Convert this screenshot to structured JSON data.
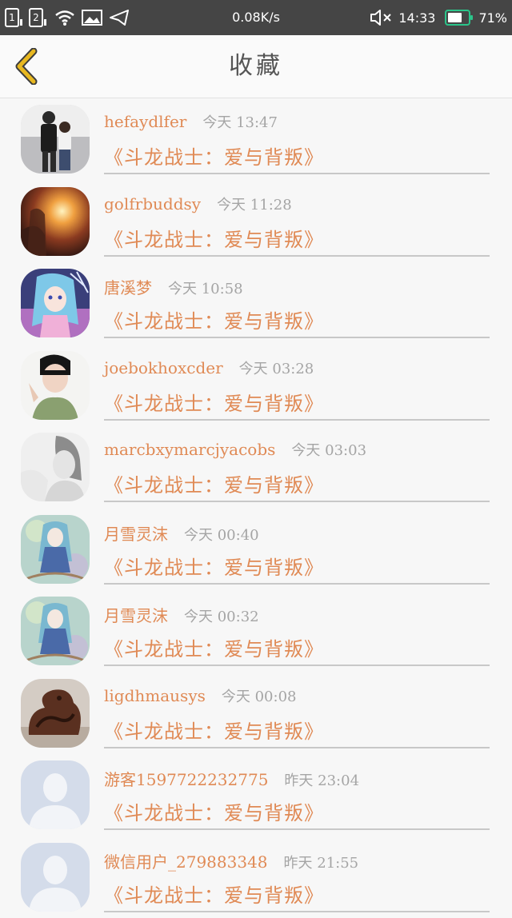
{
  "status_bar": {
    "sim1": "1",
    "sim2": "2",
    "speed": "0.08K/s",
    "time": "14:33",
    "battery": "71%",
    "battery_level": 0.71,
    "battery_color": "#2bc58a"
  },
  "nav": {
    "title": "收藏",
    "back_icon": "chevron-left-icon",
    "back_color": "#e8b820"
  },
  "accent_color": "#e08a55",
  "favorites": [
    {
      "user": "hefaydlfer",
      "time": "今天 13:47",
      "story": "《斗龙战士：爱与背叛》",
      "avatar": "photo"
    },
    {
      "user": "golfrbuddsy",
      "time": "今天 11:28",
      "story": "《斗龙战士：爱与背叛》",
      "avatar": "photo"
    },
    {
      "user": "唐溪梦",
      "time": "今天 10:58",
      "story": "《斗龙战士：爱与背叛》",
      "avatar": "photo"
    },
    {
      "user": "joebokhoxcder",
      "time": "今天 03:28",
      "story": "《斗龙战士：爱与背叛》",
      "avatar": "photo"
    },
    {
      "user": "marcbxymarcjyacobs",
      "time": "今天 03:03",
      "story": "《斗龙战士：爱与背叛》",
      "avatar": "photo"
    },
    {
      "user": "月雪灵沫",
      "time": "今天 00:40",
      "story": "《斗龙战士：爱与背叛》",
      "avatar": "photo"
    },
    {
      "user": "月雪灵沫",
      "time": "今天 00:32",
      "story": "《斗龙战士：爱与背叛》",
      "avatar": "photo"
    },
    {
      "user": "ligdhmausys",
      "time": "今天 00:08",
      "story": "《斗龙战士：爱与背叛》",
      "avatar": "photo"
    },
    {
      "user": "游客1597722232775",
      "time": "昨天 23:04",
      "story": "《斗龙战士：爱与背叛》",
      "avatar": "default-user-icon"
    },
    {
      "user": "微信用户_279883348",
      "time": "昨天 21:55",
      "story": "《斗龙战士：爱与背叛》",
      "avatar": "default-user-icon"
    }
  ]
}
